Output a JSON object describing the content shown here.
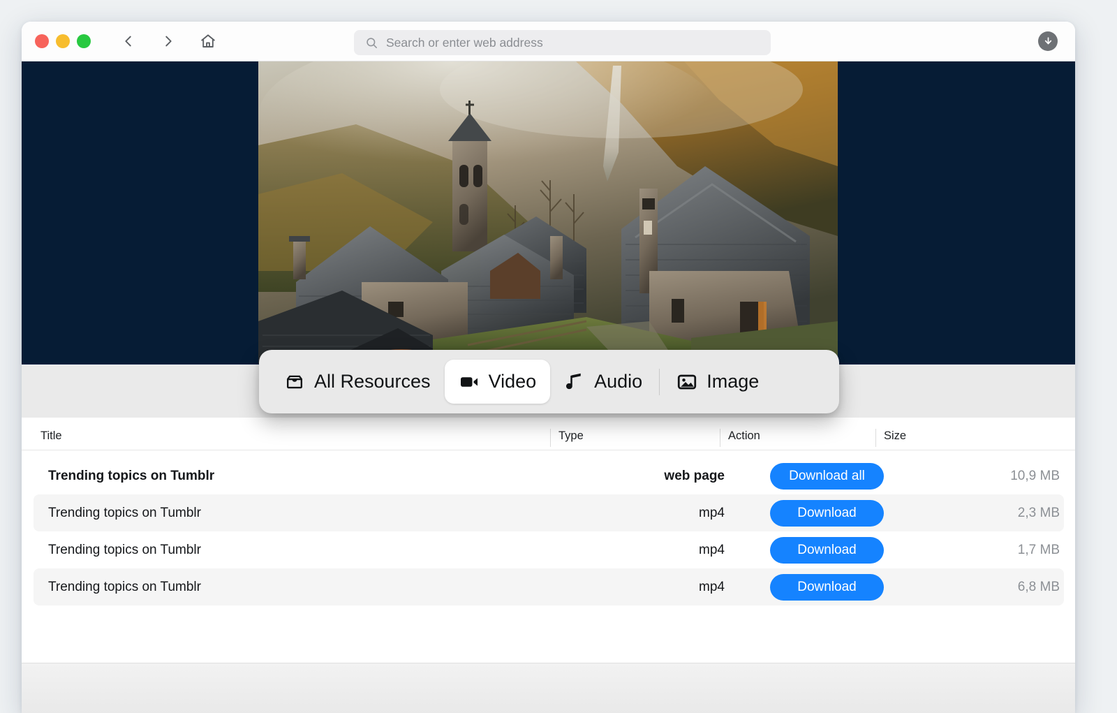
{
  "window": {
    "traffic_lights": [
      {
        "name": "close",
        "color": "#f7635b"
      },
      {
        "name": "minimize",
        "color": "#f7bd2e"
      },
      {
        "name": "zoom",
        "color": "#28c940"
      }
    ]
  },
  "toolbar": {
    "back_label": "Back",
    "forward_label": "Forward",
    "home_label": "Home",
    "downloads_label": "Downloads",
    "search": {
      "value": "",
      "placeholder": "Search or enter web address",
      "icon": "search-icon"
    }
  },
  "hero": {
    "background_color": "#061c35",
    "image_alt": "Alpine stone village with church tower, slate roofs and misty autumn hillside"
  },
  "filters": {
    "tabs": [
      {
        "label": "All Resources",
        "icon": "inbox-icon",
        "active": false
      },
      {
        "label": "Video",
        "icon": "video-icon",
        "active": true
      },
      {
        "label": "Audio",
        "icon": "music-icon",
        "active": false
      },
      {
        "label": "Image",
        "icon": "picture-icon",
        "active": false
      }
    ]
  },
  "table": {
    "columns": [
      "Title",
      "Type",
      "Action",
      "Size"
    ],
    "rows": [
      {
        "title": "Trending topics on Tumblr",
        "type": "web page",
        "action": "Download all",
        "size": "10,9 MB",
        "primary": true,
        "alt": false
      },
      {
        "title": "Trending topics on Tumblr",
        "type": "mp4",
        "action": "Download",
        "size": "2,3 MB",
        "primary": false,
        "alt": true
      },
      {
        "title": "Trending topics on Tumblr",
        "type": "mp4",
        "action": "Download",
        "size": "1,7 MB",
        "primary": false,
        "alt": false
      },
      {
        "title": "Trending topics on Tumblr",
        "type": "mp4",
        "action": "Download",
        "size": "6,8 MB",
        "primary": false,
        "alt": true
      }
    ]
  },
  "colors": {
    "accent_blue": "#1583ff",
    "hero_navy": "#061c35",
    "filter_bar_bg": "#e9e9e9",
    "row_alt_bg": "#f5f5f5",
    "size_text": "#8c9095"
  }
}
